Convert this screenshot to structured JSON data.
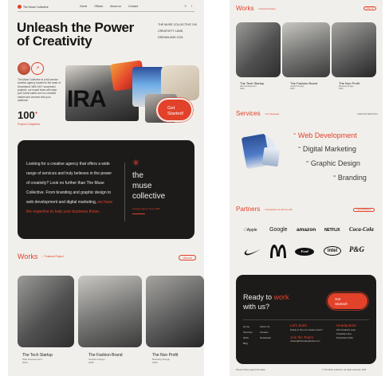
{
  "left": {
    "brand": "The Muse Collective",
    "nav": [
      "Home",
      "Offices",
      "About us",
      "Contact"
    ],
    "hero_title_line1": "Unleash the Power",
    "hero_title_line2": "of Creativity",
    "address": [
      "THE MUSE COLLECTIVE 100",
      "CREATIVITY LANE,",
      "DREAMLAND 1234"
    ],
    "intro_text": "The Muse Collective is a full-service creative agency located in the heart of Dreamland. With 100+ successful projects, our expert team will make your brand stand out in a crowded market and connect with your audience.",
    "stat_value": "100",
    "stat_sup": "+",
    "stat_label": "Project Completed",
    "cta_label": "Get Started!",
    "about_text_1": "Looking for a creative agency that offers a wide range of services and truly believes in the power of creativity? Look no further than The Muse Collective. From branding and graphic design to web development and digital marketing,",
    "about_text_2": " we have the expertise to help your business thrive.",
    "about_brand": [
      "the",
      "muse",
      "collective"
    ],
    "about_brand_small": "Creative agency since 2005",
    "works_title": "Works",
    "works_sub": "Featured Project",
    "view_all": "View all",
    "projects": [
      {
        "title": "The Tech Startup",
        "category": "Web Development",
        "year": "2022"
      },
      {
        "title": "The Fashion Brand",
        "category": "Graphic Design",
        "year": "2022"
      },
      {
        "title": "The Non Profit",
        "category": "Branding Design",
        "year": "2022"
      }
    ]
  },
  "right": {
    "works_title": "Works",
    "works_sub": "Featured Project",
    "view_all": "View all",
    "projects": [
      {
        "title": "The Tech Startup",
        "category": "Web Development",
        "year": "2022"
      },
      {
        "title": "The Fashion Brand",
        "category": "Graphic Design",
        "year": "2022"
      },
      {
        "title": "The Non Profit",
        "category": "Branding Design",
        "year": "2022"
      }
    ],
    "services_title": "Services",
    "services_sub": "Our Expertise",
    "services_right": "CREATIVE SERVICES",
    "services": [
      {
        "num": "01",
        "label": "Web Development"
      },
      {
        "num": "02",
        "label": "Digital Marketing"
      },
      {
        "num": "03",
        "label": "Graphic Design"
      },
      {
        "num": "04",
        "label": "Branding"
      }
    ],
    "partners_title": "Partners",
    "partners_sub": "Companies we partner with",
    "partners_view": "View all Partners",
    "logos_row1": [
      "Apple",
      "Google",
      "amazon",
      "NETFLIX",
      "Coca-Cola"
    ],
    "logos_row2": [
      "Nike",
      "McDonald's",
      "Ford",
      "intel",
      "P&G"
    ],
    "footer_title_1": "Ready to ",
    "footer_title_accent": "work",
    "footer_title_2": "with us?",
    "footer_cta": "Get Started!",
    "footer_links_a": [
      "Home",
      "Services",
      "Work",
      "Blog"
    ],
    "footer_links_b": [
      "About Us",
      "Careers",
      "Newsletter"
    ],
    "lets_build": "Let's Build",
    "lets_build_text": "Ready to hire our creative team?",
    "join_team": "Join the Team!",
    "join_email": "careers@themusecollective.com",
    "hq_title": "Headquarter",
    "hq_lines": [
      "100 Creativity Lane",
      "Creativity Lane,",
      "Dreamland 1234"
    ],
    "bottom_left": "Privacy Policy   Legal Information",
    "bottom_right": "© The Muse Collective. All rights reserved. 2023",
    "accent": "#e2412a"
  }
}
